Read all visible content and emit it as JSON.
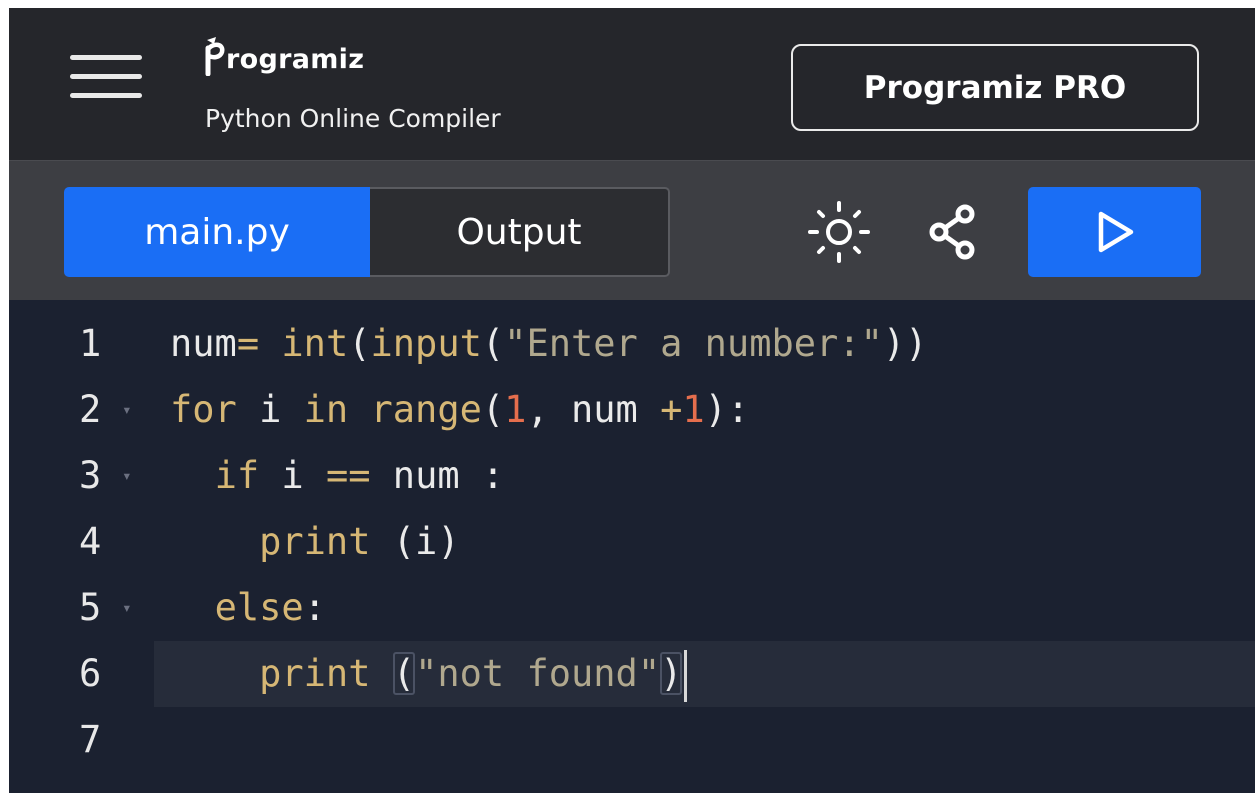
{
  "header": {
    "brand_name": "rogramiz",
    "subtitle": "Python Online Compiler",
    "pro_button_label": "Programiz PRO"
  },
  "toolbar": {
    "tabs": [
      {
        "label": "main.py",
        "active": true
      },
      {
        "label": "Output",
        "active": false
      }
    ],
    "icons": [
      "hamburger-menu-icon",
      "sun-theme-icon",
      "share-icon",
      "play-icon"
    ]
  },
  "editor": {
    "lines": [
      {
        "number": "1",
        "foldable": false,
        "active": false,
        "tokens": [
          {
            "t": "num",
            "c": "var"
          },
          {
            "t": "= ",
            "c": "op"
          },
          {
            "t": "int",
            "c": "fn"
          },
          {
            "t": "(",
            "c": "punc"
          },
          {
            "t": "input",
            "c": "fn"
          },
          {
            "t": "(",
            "c": "punc"
          },
          {
            "t": "\"Enter a number:\"",
            "c": "str"
          },
          {
            "t": "))",
            "c": "punc"
          }
        ]
      },
      {
        "number": "2",
        "foldable": true,
        "active": false,
        "tokens": [
          {
            "t": "for",
            "c": "kw"
          },
          {
            "t": " i ",
            "c": "var"
          },
          {
            "t": "in",
            "c": "kw"
          },
          {
            "t": " ",
            "c": "var"
          },
          {
            "t": "range",
            "c": "fn"
          },
          {
            "t": "(",
            "c": "punc"
          },
          {
            "t": "1",
            "c": "num"
          },
          {
            "t": ", num ",
            "c": "var"
          },
          {
            "t": "+",
            "c": "op"
          },
          {
            "t": "1",
            "c": "num"
          },
          {
            "t": "):",
            "c": "punc"
          }
        ]
      },
      {
        "number": "3",
        "foldable": true,
        "active": false,
        "tokens": [
          {
            "t": "  ",
            "c": "var"
          },
          {
            "t": "if",
            "c": "kw"
          },
          {
            "t": " i ",
            "c": "var"
          },
          {
            "t": "==",
            "c": "op"
          },
          {
            "t": " num :",
            "c": "var"
          }
        ]
      },
      {
        "number": "4",
        "foldable": false,
        "active": false,
        "tokens": [
          {
            "t": "    ",
            "c": "var"
          },
          {
            "t": "print",
            "c": "fn"
          },
          {
            "t": " (i)",
            "c": "punc"
          }
        ]
      },
      {
        "number": "5",
        "foldable": true,
        "active": false,
        "tokens": [
          {
            "t": "  ",
            "c": "var"
          },
          {
            "t": "else",
            "c": "kw"
          },
          {
            "t": ":",
            "c": "punc"
          }
        ]
      },
      {
        "number": "6",
        "foldable": false,
        "active": true,
        "tokens": [
          {
            "t": "    ",
            "c": "var"
          },
          {
            "t": "print",
            "c": "fn"
          },
          {
            "t": " ",
            "c": "var"
          },
          {
            "t": "(",
            "c": "punc",
            "match": true
          },
          {
            "t": "\"not found\"",
            "c": "str"
          },
          {
            "t": ")",
            "c": "punc",
            "match": true
          }
        ],
        "cursor": true
      },
      {
        "number": "7",
        "foldable": false,
        "active": false,
        "tokens": []
      }
    ]
  },
  "colors": {
    "accent_blue": "#1a6ef5",
    "header_bg": "#25262b",
    "toolbar_bg": "#3d3e43",
    "editor_bg": "#1b2130"
  }
}
